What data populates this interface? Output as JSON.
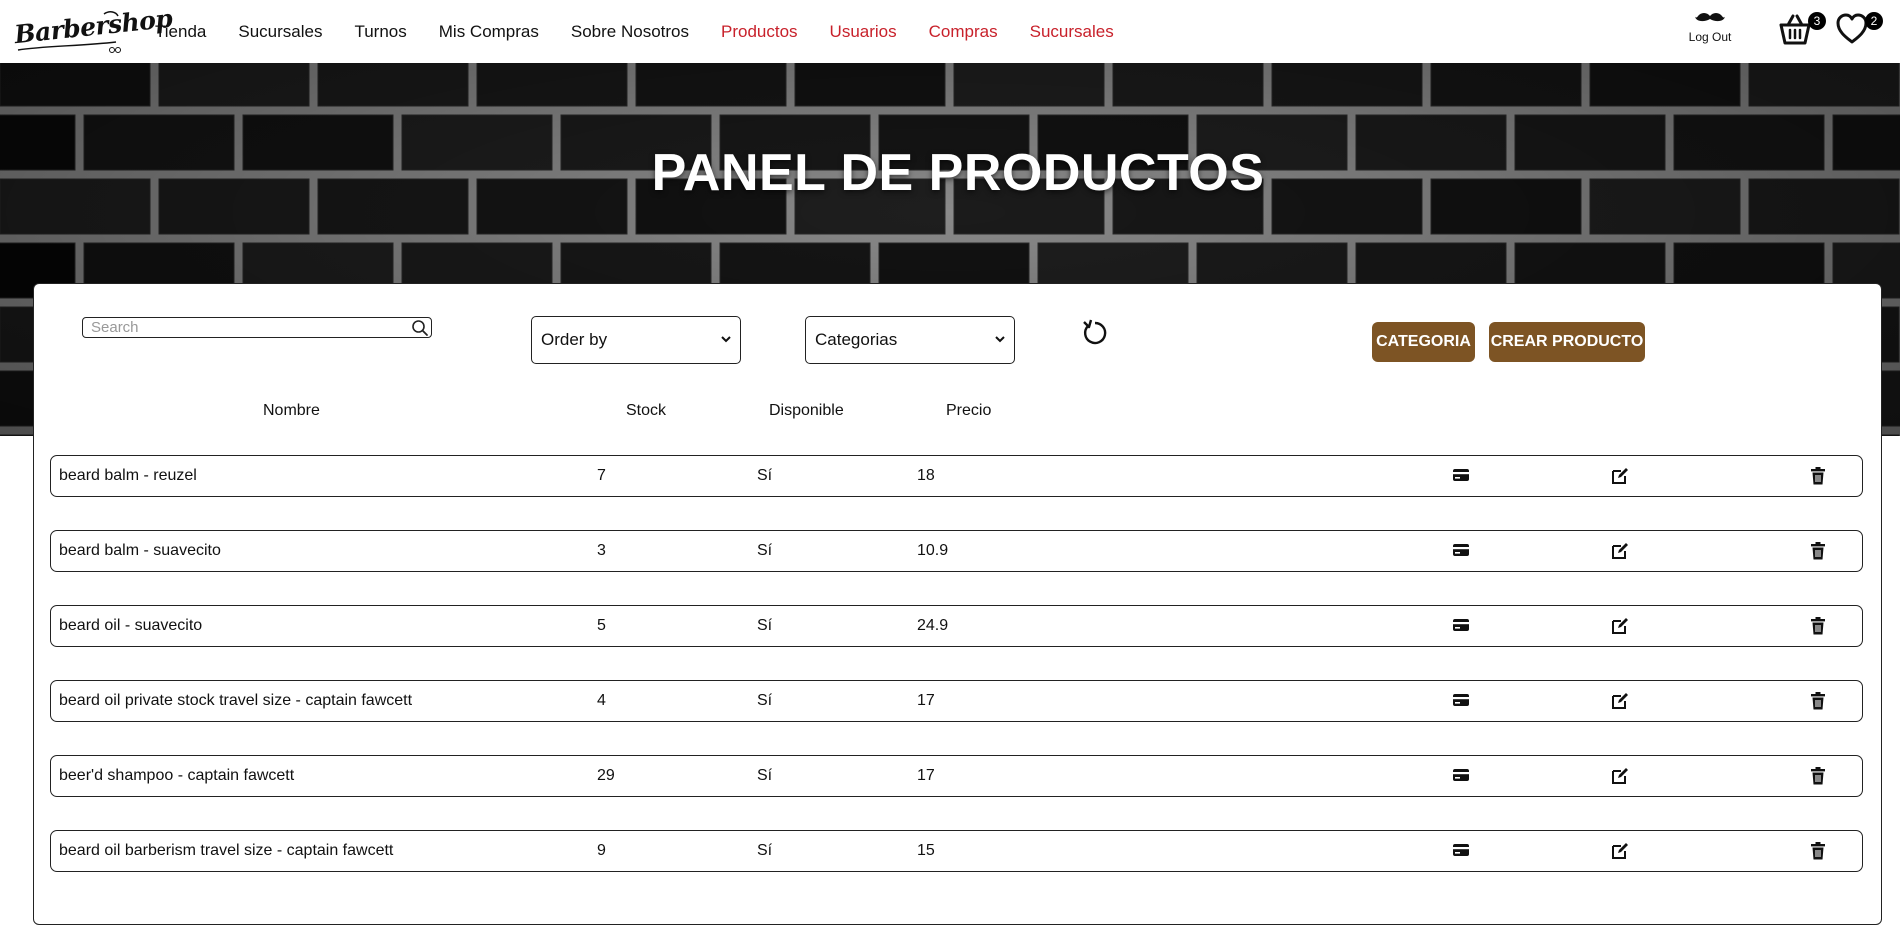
{
  "brand": {
    "logo_text": "Barbershop"
  },
  "nav": {
    "links": [
      "Tienda",
      "Sucursales",
      "Turnos",
      "Mis Compras",
      "Sobre Nosotros"
    ],
    "admin_links": [
      "Productos",
      "Usuarios",
      "Compras",
      "Sucursales"
    ],
    "logout_label": "Log Out",
    "cart_count": "3",
    "favorites_count": "2"
  },
  "hero": {
    "title": "PANEL DE PRODUCTOS"
  },
  "toolbar": {
    "search_placeholder": "Search",
    "order_by_value": "Order by",
    "categories_value": "Categorias",
    "categoria_button": "CATEGORIA",
    "crear_producto_button": "CREAR PRODUCTO"
  },
  "table": {
    "headers": {
      "name": "Nombre",
      "stock": "Stock",
      "available": "Disponible",
      "price": "Precio"
    },
    "rows": [
      {
        "name": "beard balm - reuzel",
        "stock": "7",
        "available": "Sí",
        "price": "18"
      },
      {
        "name": "beard balm - suavecito",
        "stock": "3",
        "available": "Sí",
        "price": "10.9"
      },
      {
        "name": "beard oil - suavecito",
        "stock": "5",
        "available": "Sí",
        "price": "24.9"
      },
      {
        "name": "beard oil private stock travel size - captain fawcett",
        "stock": "4",
        "available": "Sí",
        "price": "17"
      },
      {
        "name": "beer'd shampoo - captain fawcett",
        "stock": "29",
        "available": "Sí",
        "price": "17"
      },
      {
        "name": "beard oil barberism travel size - captain fawcett",
        "stock": "9",
        "available": "Sí",
        "price": "15"
      }
    ]
  },
  "colors": {
    "admin_link": "#c8212b",
    "button": "#7d5424",
    "hero_background": "#161616"
  },
  "icons": {
    "row_actions": [
      "credit-card-icon",
      "edit-icon",
      "trash-icon"
    ]
  }
}
